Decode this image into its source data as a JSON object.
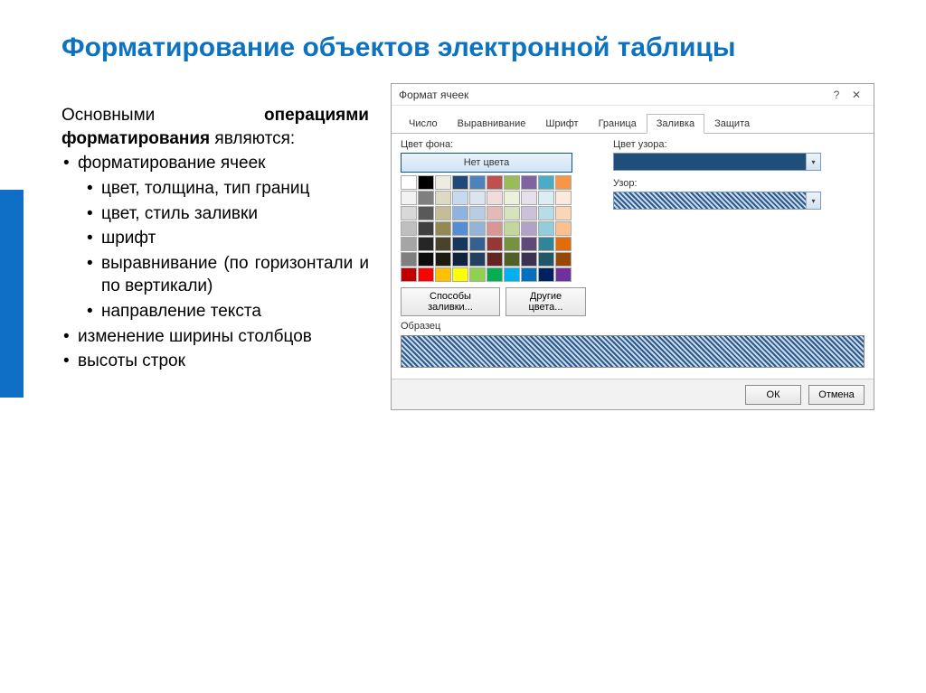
{
  "slide": {
    "title": "Форматирование объектов электронной таблицы",
    "intro_plain1": "Основными ",
    "intro_bold": "операциями форматирования",
    "intro_plain2": " являются:",
    "bullets_l1": [
      "форматирование ячеек",
      "изменение ширины столбцов",
      "высоты строк"
    ],
    "bullets_l2": [
      "цвет, толщина, тип границ",
      "цвет, стиль заливки",
      "шрифт",
      "выравнивание (по горизонтали и по вертикали)",
      "направление текста"
    ]
  },
  "dialog": {
    "title": "Формат ячеек",
    "tabs": [
      "Число",
      "Выравнивание",
      "Шрифт",
      "Граница",
      "Заливка",
      "Защита"
    ],
    "active_tab_index": 4,
    "labels": {
      "bg_color": "Цвет фона:",
      "no_color": "Нет цвета",
      "pattern_color": "Цвет узора:",
      "pattern": "Узор:",
      "sample": "Образец",
      "fill_effects": "Способы заливки...",
      "more_colors": "Другие цвета..."
    },
    "buttons": {
      "ok": "ОК",
      "cancel": "Отмена"
    },
    "palette": [
      [
        "#ffffff",
        "#000000",
        "#eeece1",
        "#1f497d",
        "#4f81bd",
        "#c0504d",
        "#9bbb59",
        "#8064a2",
        "#4bacc6",
        "#f79646"
      ],
      [
        "#f2f2f2",
        "#7f7f7f",
        "#ddd9c3",
        "#c6d9f0",
        "#dbe5f1",
        "#f2dcdb",
        "#ebf1dd",
        "#e5e0ec",
        "#dbeef3",
        "#fdeada"
      ],
      [
        "#d8d8d8",
        "#595959",
        "#c4bd97",
        "#8db3e2",
        "#b8cce4",
        "#e5b9b7",
        "#d7e3bc",
        "#ccc1d9",
        "#b7dde8",
        "#fbd5b5"
      ],
      [
        "#bfbfbf",
        "#3f3f3f",
        "#938953",
        "#548dd4",
        "#95b3d7",
        "#d99694",
        "#c3d69b",
        "#b2a2c7",
        "#92cddc",
        "#fac08f"
      ],
      [
        "#a5a5a5",
        "#262626",
        "#494429",
        "#17365d",
        "#366092",
        "#953734",
        "#76923c",
        "#5f497a",
        "#31859b",
        "#e36c09"
      ],
      [
        "#7f7f7f",
        "#0c0c0c",
        "#1d1b10",
        "#0f243e",
        "#244061",
        "#632423",
        "#4f6128",
        "#3f3151",
        "#205867",
        "#974806"
      ],
      [
        "#c00000",
        "#ff0000",
        "#ffc000",
        "#ffff00",
        "#92d050",
        "#00b050",
        "#00b0f0",
        "#0070c0",
        "#002060",
        "#7030a0"
      ]
    ]
  }
}
